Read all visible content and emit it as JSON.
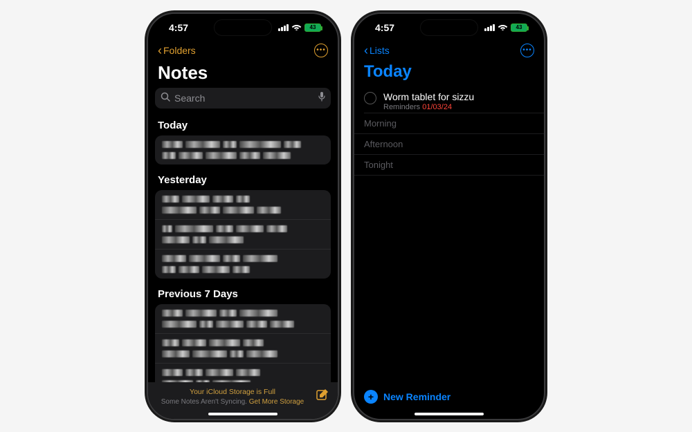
{
  "status": {
    "time": "4:57",
    "battery_label": "43"
  },
  "notes": {
    "back_label": "Folders",
    "title": "Notes",
    "search_placeholder": "Search",
    "sections": {
      "today": "Today",
      "yesterday": "Yesterday",
      "prev7": "Previous 7 Days"
    },
    "footer": {
      "line1": "Your iCloud Storage is Full",
      "line2a": "Some Notes Aren't Syncing.",
      "line2b": "Get More Storage"
    }
  },
  "reminders": {
    "back_label": "Lists",
    "title": "Today",
    "item": {
      "title": "Worm tablet for sizzu",
      "sub_label": "Reminders",
      "date": "01/03/24"
    },
    "sections": {
      "morning": "Morning",
      "afternoon": "Afternoon",
      "tonight": "Tonight"
    },
    "new_reminder": "New Reminder"
  }
}
